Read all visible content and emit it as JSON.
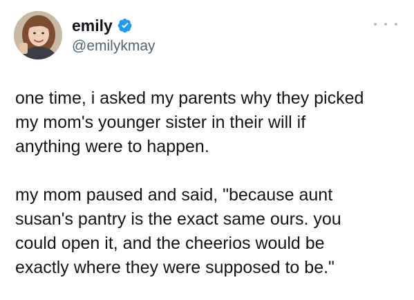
{
  "author": {
    "display_name": "emily",
    "handle": "@emilykmay",
    "verified": true,
    "avatar_icon": "profile-photo"
  },
  "menu": {
    "icon": "more-horizontal-icon"
  },
  "tweet": {
    "paragraphs": [
      {
        "lines": [
          "one time, i asked my parents why they picked",
          "my mom's younger sister in their will if",
          "anything were to happen."
        ]
      },
      {
        "lines": [
          "my mom paused and said, \"because aunt",
          "susan's pantry is the exact same ours. you",
          "could open it, and the cheerios would be",
          "exactly where they were supposed to be.\""
        ]
      }
    ]
  },
  "colors": {
    "text": "#0f1419",
    "secondary_text": "#536471",
    "verified_badge": "#1d9bf0",
    "background": "#ffffff"
  }
}
